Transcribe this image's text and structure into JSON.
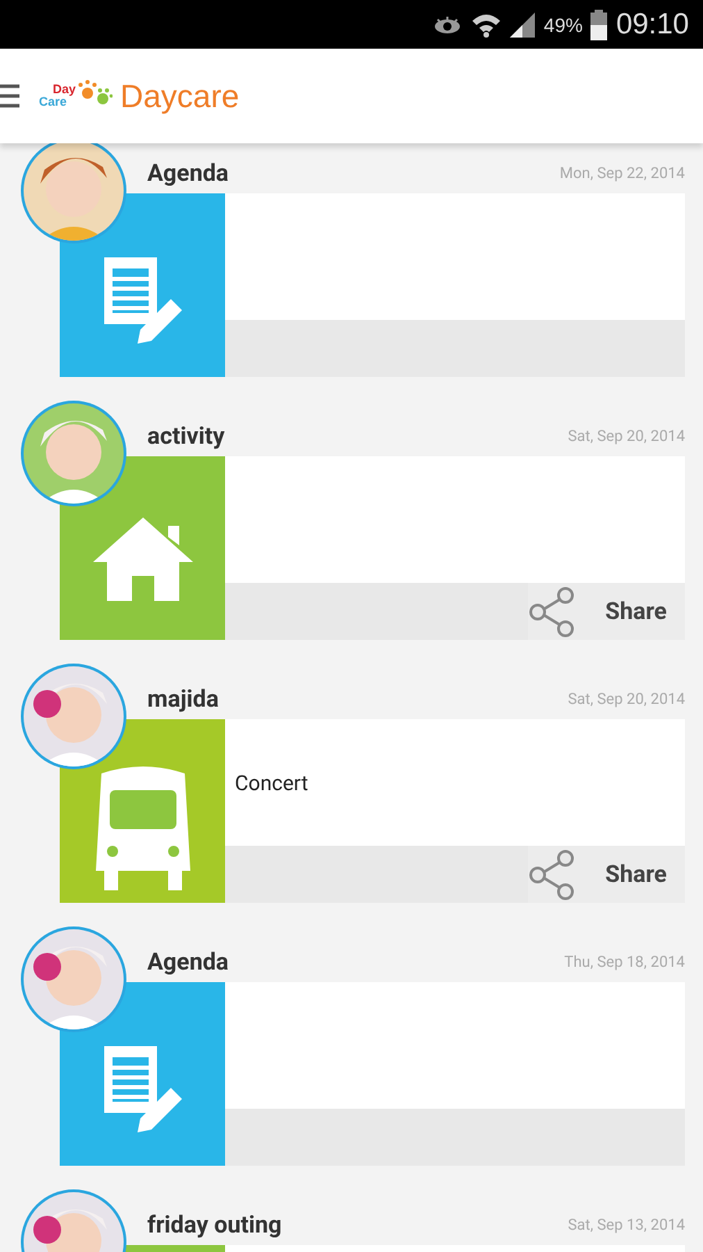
{
  "status_bar": {
    "battery": "49%",
    "time": "09:10"
  },
  "app_bar": {
    "logo": {
      "top": "Day",
      "bottom": "Care"
    },
    "title": "Daycare"
  },
  "entries": [
    {
      "title": "Agenda",
      "date": "Mon, Sep 22, 2014",
      "kind": "document",
      "color": "#29b6e8"
    },
    {
      "title": "activity",
      "date": "Sat, Sep 20, 2014",
      "kind": "house",
      "color": "#8dc63f",
      "share": "Share"
    },
    {
      "title": "majida",
      "date": "Sat, Sep 20, 2014",
      "kind": "bus",
      "color": "#a5c928",
      "body": "Concert",
      "share": "Share"
    },
    {
      "title": "Agenda",
      "date": "Thu, Sep 18, 2014",
      "kind": "document",
      "color": "#29b6e8"
    },
    {
      "title": "friday outing",
      "date": "Sat, Sep 13, 2014",
      "color": "#8dc63f"
    }
  ]
}
